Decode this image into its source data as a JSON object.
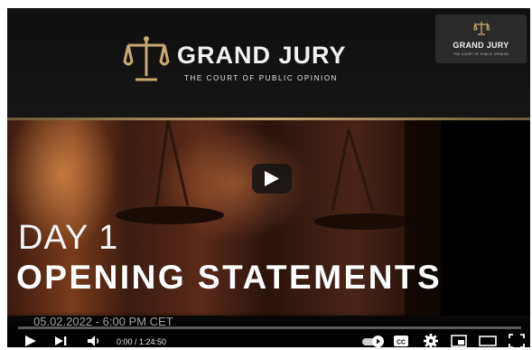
{
  "banner": {
    "title": "GRAND JURY",
    "subtitle": "THE COURT OF PUBLIC OPINION"
  },
  "watermark": {
    "title": "GRAND JURY",
    "subtitle": "THE COURT OF PUBLIC OPINION"
  },
  "scene": {
    "day": "DAY 1",
    "headline": "OPENING STATEMENTS"
  },
  "player": {
    "date_caption": "05.02.2022 - 6:00 PM CET",
    "time_display": "0:00 / 1:24:50",
    "progress": 0.0
  },
  "colors": {
    "gold": "#c8a96f",
    "progress_red": "#ff0000"
  },
  "icons": [
    "play-icon",
    "next-icon",
    "volume-icon",
    "autoplay-toggle-icon",
    "captions-icon",
    "settings-icon",
    "miniplayer-icon",
    "theater-icon",
    "fullscreen-icon"
  ]
}
